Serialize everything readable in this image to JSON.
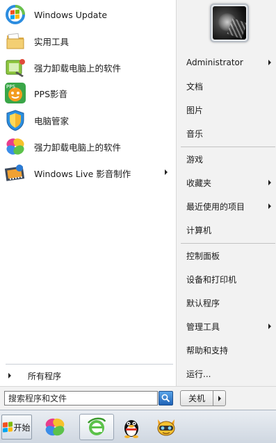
{
  "programs": [
    {
      "label": "Windows Update",
      "icon": "windows-update-icon",
      "has_submenu": false
    },
    {
      "label": "实用工具",
      "icon": "folder-icon",
      "has_submenu": false
    },
    {
      "label": "强力卸载电脑上的软件",
      "icon": "uninstaller-icon",
      "has_submenu": false
    },
    {
      "label": "PPS影音",
      "icon": "pps-icon",
      "has_submenu": false
    },
    {
      "label": "电脑管家",
      "icon": "pc-manager-shield-icon",
      "has_submenu": false
    },
    {
      "label": "强力卸载电脑上的软件",
      "icon": "colorful-petals-icon",
      "has_submenu": false
    },
    {
      "label": "Windows Live 影音制作",
      "icon": "movie-maker-icon",
      "has_submenu": true
    }
  ],
  "all_programs_label": "所有程序",
  "right_menu": [
    {
      "label": "Administrator",
      "has_submenu": true
    },
    {
      "label": "文档",
      "has_submenu": false
    },
    {
      "label": "图片",
      "has_submenu": false
    },
    {
      "label": "音乐",
      "has_submenu": false
    },
    {
      "label": "游戏",
      "has_submenu": false
    },
    {
      "label": "收藏夹",
      "has_submenu": true
    },
    {
      "label": "最近使用的项目",
      "has_submenu": true
    },
    {
      "label": "计算机",
      "has_submenu": false
    },
    {
      "label": "控制面板",
      "has_submenu": false
    },
    {
      "label": "设备和打印机",
      "has_submenu": false
    },
    {
      "label": "默认程序",
      "has_submenu": false
    },
    {
      "label": "管理工具",
      "has_submenu": true
    },
    {
      "label": "帮助和支持",
      "has_submenu": false
    },
    {
      "label": "运行...",
      "has_submenu": false
    }
  ],
  "search": {
    "placeholder": "搜索程序和文件"
  },
  "shutdown_label": "关机",
  "taskbar": {
    "start_label": "开始",
    "pinned": [
      "colorful-petals-icon",
      "ie-icon",
      "qq-penguin-icon",
      "game-character-icon"
    ]
  },
  "colors": {
    "right_pane_bg": "#f2f2f2",
    "taskbar_bg": "#d6dde6",
    "search_button": "#1f63b7"
  }
}
